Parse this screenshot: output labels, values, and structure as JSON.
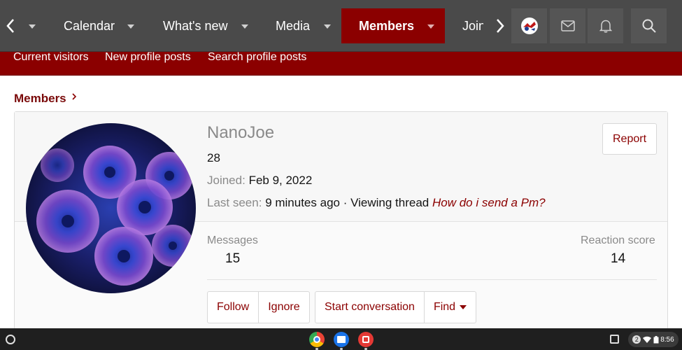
{
  "topnav": {
    "items": [
      {
        "label": "Calendar"
      },
      {
        "label": "What's new"
      },
      {
        "label": "Media"
      },
      {
        "label": "Members"
      },
      {
        "label": "Join"
      }
    ]
  },
  "subnav": {
    "links": [
      {
        "label": "Current visitors"
      },
      {
        "label": "New profile posts"
      },
      {
        "label": "Search profile posts"
      }
    ]
  },
  "breadcrumb": {
    "label": "Members"
  },
  "profile": {
    "username": "NanoJoe",
    "age": "28",
    "joined_label": "Joined:",
    "joined_value": "Feb 9, 2022",
    "last_seen_label": "Last seen:",
    "last_seen_value": "9 minutes ago",
    "activity_prefix": "· Viewing thread",
    "activity_thread": "How do i send a Pm?",
    "report_label": "Report"
  },
  "stats": {
    "messages_label": "Messages",
    "messages_value": "15",
    "reaction_label": "Reaction score",
    "reaction_value": "14"
  },
  "actions": {
    "follow": "Follow",
    "ignore": "Ignore",
    "start_conversation": "Start conversation",
    "find": "Find"
  },
  "shelf": {
    "notification_count": "2",
    "clock": "8:56"
  },
  "colors": {
    "accent": "#8b0000",
    "nav_bg": "#4a4a4a"
  }
}
